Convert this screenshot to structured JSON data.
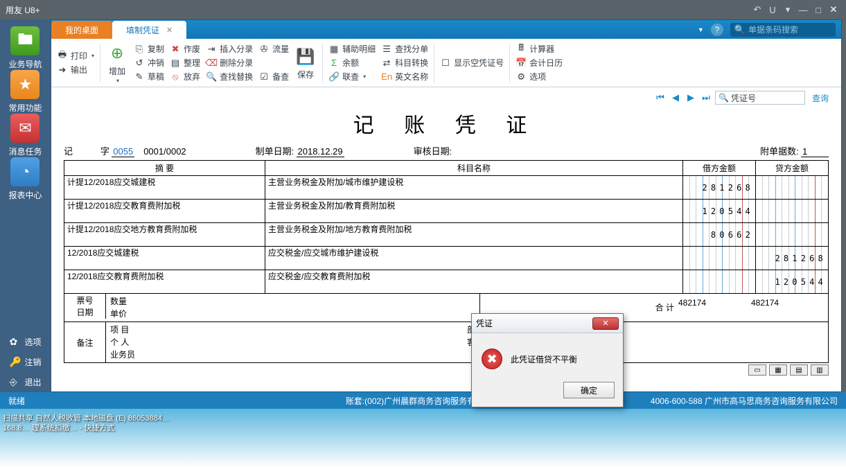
{
  "app_title": "用友 U8+",
  "title_buttons": {
    "undo": "↶",
    "u": "U",
    "tri": "▾",
    "min": "—",
    "max": "□",
    "close": "✕"
  },
  "leftnav": {
    "items": [
      {
        "label": "业务导航",
        "glyph": "🖿",
        "cls": "green"
      },
      {
        "label": "常用功能",
        "glyph": "★",
        "cls": "orange"
      },
      {
        "label": "消息任务",
        "glyph": "✉",
        "cls": "red"
      },
      {
        "label": "报表中心",
        "glyph": "◔",
        "cls": "blue"
      }
    ],
    "foot": [
      {
        "label": "选项",
        "glyph": "✿"
      },
      {
        "label": "注销",
        "glyph": "🔑"
      },
      {
        "label": "退出",
        "glyph": "⎆"
      }
    ]
  },
  "tabs": {
    "inactive": "我的桌面",
    "active": "填制凭证"
  },
  "search_placeholder": "单据条码搜索",
  "ribbon": {
    "print": "打印",
    "output": "输出",
    "add": "增加",
    "copy": "复制",
    "offset": "冲销",
    "draft": "草稿",
    "invalid": "作废",
    "arrange": "整理",
    "abandon": "放弃",
    "insert": "插入分录",
    "delete": "删除分录",
    "findrepl": "查找替换",
    "flow": "流量",
    "save": "保存",
    "audit": "备查",
    "detail": "辅助明细",
    "balance": "余额",
    "linkchk": "联查",
    "findbill": "查找分单",
    "subjtrans": "科目转换",
    "enname": "英文名称",
    "showblank": "显示空凭证号",
    "calc": "计算器",
    "calendar": "会计日历",
    "option": "选项"
  },
  "navrow": {
    "field": "凭证号",
    "query": "查询"
  },
  "doc": {
    "title": "记 账 凭 证",
    "meta": {
      "ji": "记",
      "zi": "字",
      "num": "0055",
      "seq": "0001/0002",
      "makedate_lbl": "制单日期:",
      "makedate": "2018.12.29",
      "auditdate_lbl": "审核日期:",
      "attach_lbl": "附单据数:",
      "attach": "1"
    },
    "headers": {
      "summary": "摘 要",
      "subject": "科目名称",
      "debit": "借方金额",
      "credit": "贷方金额"
    },
    "rows": [
      {
        "s": "计提12/2018应交城建税",
        "k": "主营业务税金及附加/城市维护建设税",
        "d": "281268",
        "c": ""
      },
      {
        "s": "计提12/2018应交教育费附加税",
        "k": "主营业务税金及附加/教育费附加税",
        "d": "120544",
        "c": ""
      },
      {
        "s": "计提12/2018应交地方教育费附加税",
        "k": "主营业务税金及附加/地方教育费附加税",
        "d": "80662",
        "c": ""
      },
      {
        "s": "12/2018应交城建税",
        "k": "应交税金/应交城市维护建设税",
        "d": "",
        "c": "281268"
      },
      {
        "s": "12/2018应交教育费附加税",
        "k": "应交税金/应交教育费附加税",
        "d": "",
        "c": "120544"
      }
    ],
    "sum": {
      "label": "合 计",
      "d": "482174",
      "c": "482174"
    },
    "extras": {
      "top": {
        "piaohao": "票号",
        "riqi": "日期",
        "shuliang": "数量",
        "danjia": "单价"
      },
      "beizhu": "备注",
      "xiangmu": "项 目",
      "bumen": "部 门",
      "geren": "个 人",
      "kehu": "客 户",
      "yewuyuan": "业务员"
    }
  },
  "dialog": {
    "title": "凭证",
    "msg": "此凭证借贷不平衡",
    "ok": "确定"
  },
  "status": {
    "ready": "就绪",
    "mid": "账套:(002)广州晨群商务咨询服务有限公…",
    "right": "4006-600-588 广州市高马思商务咨询服务有限公司"
  },
  "taskbar": {
    "l1": "扫描共享  自然人税收管  本地磁盘 (E)   86053884…",
    "l2": "168.8…  理系统扣缴…   - 快捷方式"
  }
}
